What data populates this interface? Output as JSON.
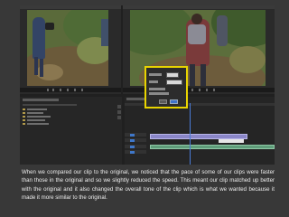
{
  "slide": {
    "caption": "When we compared our clip to the original, we noticed that the pace of some of our clips were faster than those in the original and so we slightly reduced the speed. This meant our clip matched up better with the original and it also changed the overall tone of the clip which is what we wanted because it made it more similar to the original."
  },
  "colors": {
    "slide_background": "#383838",
    "dialog_highlight": "#e8d400",
    "video_clip": "#8a86c8",
    "audio_clip": "#5f9d7a",
    "playhead": "#4a7bd8"
  },
  "icons": [
    "play-icon",
    "step-back-icon",
    "step-forward-icon",
    "folder-icon"
  ]
}
